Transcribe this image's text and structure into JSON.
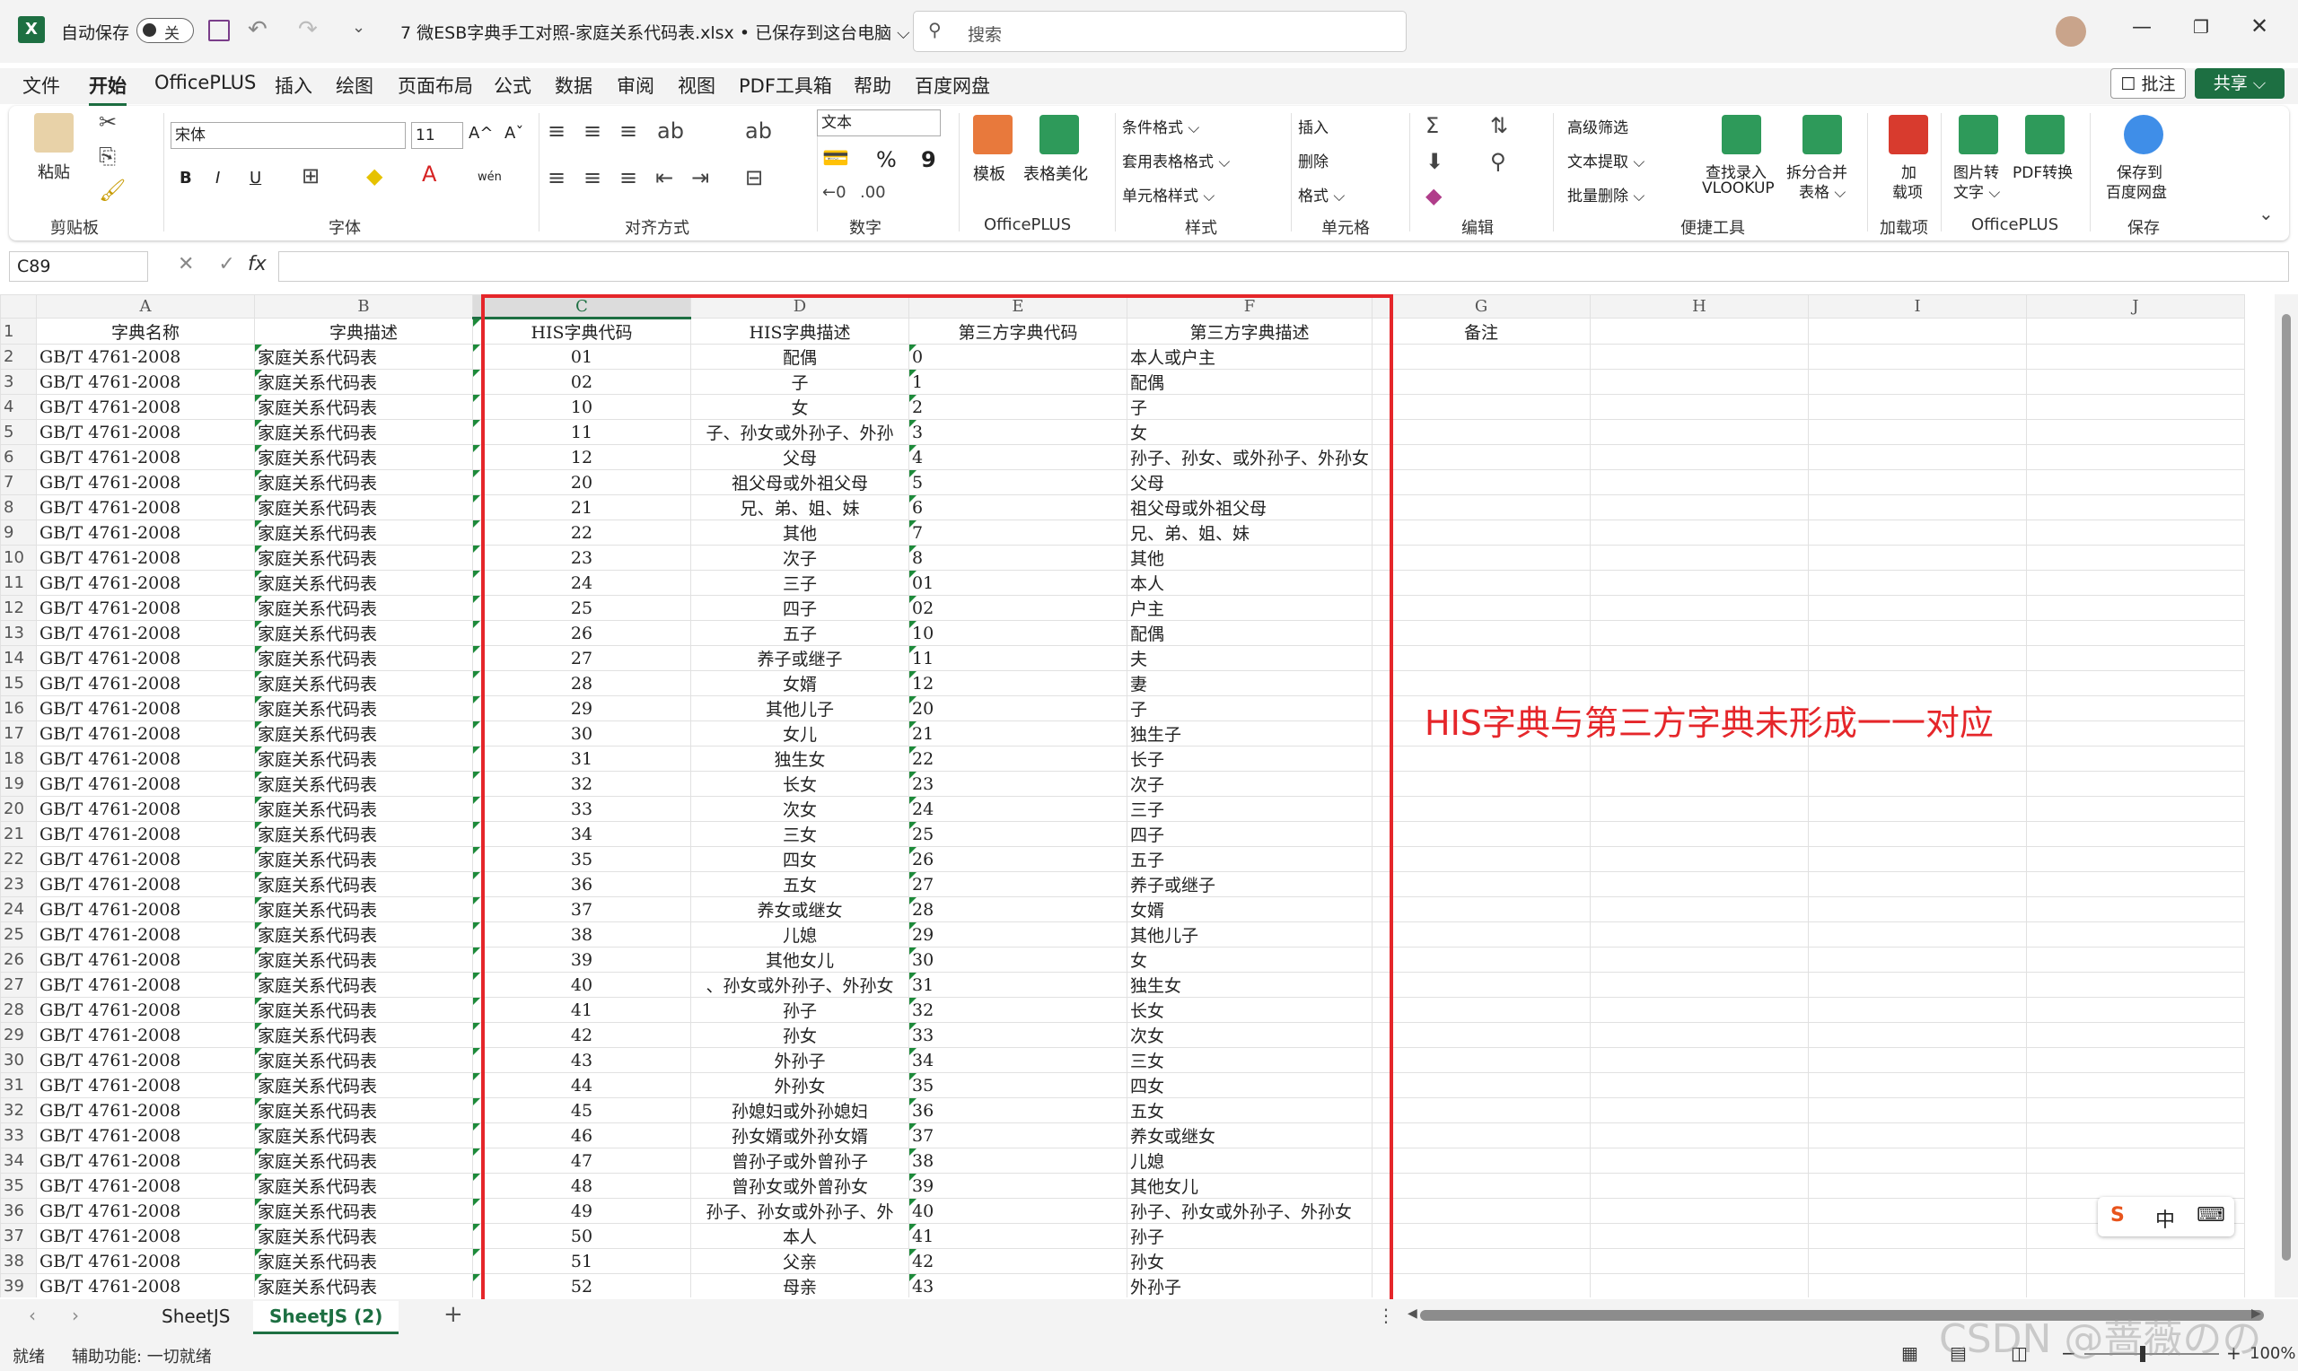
{
  "titlebar": {
    "autosave_label": "自动保存",
    "autosave_state": "关",
    "document_title": "7 微ESB字典手工对照-家庭关系代码表.xlsx • 已保存到这台电脑 ⌵",
    "search_placeholder": "搜索"
  },
  "menu_tabs": [
    "文件",
    "开始",
    "OfficePLUS",
    "插入",
    "绘图",
    "页面布局",
    "公式",
    "数据",
    "审阅",
    "视图",
    "PDF工具箱",
    "帮助",
    "百度网盘"
  ],
  "active_tab": "开始",
  "header_buttons": {
    "comment": "☐ 批注",
    "share": "共享 ⌵"
  },
  "ribbon": {
    "clipboard": {
      "paste": "粘贴",
      "label": "剪贴板"
    },
    "font": {
      "name": "宋体",
      "size": "11",
      "bold": "B",
      "italic": "I",
      "underline": "U",
      "label": "字体",
      "increase": "A^",
      "decrease": "Aˇ",
      "phonetic": "wén"
    },
    "alignment": {
      "label": "对齐方式"
    },
    "number": {
      "format": "文本",
      "percent": "%",
      "comma": "9",
      "label": "数字"
    },
    "officeplus": {
      "template": "模板",
      "beautify": "表格美化",
      "label": "OfficePLUS"
    },
    "styles": {
      "conditional": "条件格式 ⌵",
      "table_format": "套用表格格式 ⌵",
      "cell_style": "单元格样式 ⌵",
      "label": "样式"
    },
    "cells": {
      "insert": "插入",
      "delete": "删除",
      "format": "格式 ⌵",
      "label": "单元格"
    },
    "editing": {
      "label": "编辑"
    },
    "quick_tools": {
      "advanced_filter": "高级筛选",
      "text_extract": "文本提取 ⌵",
      "batch_delete": "批量删除 ⌵",
      "lookup_line1": "查找录入",
      "lookup_line2": "VLOOKUP",
      "split_line1": "拆分合并",
      "split_line2": "表格 ⌵",
      "label": "便捷工具"
    },
    "addins": {
      "line1": "加",
      "line2": "载项",
      "label": "加载项"
    },
    "officeplus2": {
      "img2text_line1": "图片转",
      "img2text_line2": "文字 ⌵",
      "pdf_convert": "PDF转换",
      "label": "OfficePLUS"
    },
    "save": {
      "line1": "保存到",
      "line2": "百度网盘",
      "label": "保存"
    }
  },
  "formula_bar": {
    "name_box": "C89",
    "fx": "fx",
    "ops": "✕ ✓",
    "formula": ""
  },
  "columns": [
    "A",
    "B",
    "C",
    "D",
    "E",
    "F",
    "G",
    "H",
    "I",
    "J"
  ],
  "selected_column": "C",
  "header_row": {
    "A": "字典名称",
    "B": "字典描述",
    "C": "HIS字典代码",
    "D": "HIS字典描述",
    "E": "第三方字典代码",
    "F": "第三方字典描述",
    "G": "备注"
  },
  "rows": [
    {
      "n": "2",
      "c": "01",
      "d": "配偶",
      "e": "0",
      "f": "本人或户主"
    },
    {
      "n": "3",
      "c": "02",
      "d": "子",
      "e": "1",
      "f": "配偶"
    },
    {
      "n": "4",
      "c": "10",
      "d": "女",
      "e": "2",
      "f": "子"
    },
    {
      "n": "5",
      "c": "11",
      "d": "子、孙女或外孙子、外孙",
      "e": "3",
      "f": "女"
    },
    {
      "n": "6",
      "c": "12",
      "d": "父母",
      "e": "4",
      "f": "孙子、孙女、或外孙子、外孙女"
    },
    {
      "n": "7",
      "c": "20",
      "d": "祖父母或外祖父母",
      "e": "5",
      "f": "父母"
    },
    {
      "n": "8",
      "c": "21",
      "d": "兄、弟、姐、妹",
      "e": "6",
      "f": "祖父母或外祖父母"
    },
    {
      "n": "9",
      "c": "22",
      "d": "其他",
      "e": "7",
      "f": "兄、弟、姐、妹"
    },
    {
      "n": "10",
      "c": "23",
      "d": "次子",
      "e": "8",
      "f": "其他"
    },
    {
      "n": "11",
      "c": "24",
      "d": "三子",
      "e": "01",
      "f": "本人"
    },
    {
      "n": "12",
      "c": "25",
      "d": "四子",
      "e": "02",
      "f": "户主"
    },
    {
      "n": "13",
      "c": "26",
      "d": "五子",
      "e": "10",
      "f": "配偶"
    },
    {
      "n": "14",
      "c": "27",
      "d": "养子或继子",
      "e": "11",
      "f": "夫"
    },
    {
      "n": "15",
      "c": "28",
      "d": "女婿",
      "e": "12",
      "f": "妻"
    },
    {
      "n": "16",
      "c": "29",
      "d": "其他儿子",
      "e": "20",
      "f": "子"
    },
    {
      "n": "17",
      "c": "30",
      "d": "女儿",
      "e": "21",
      "f": "独生子"
    },
    {
      "n": "18",
      "c": "31",
      "d": "独生女",
      "e": "22",
      "f": "长子"
    },
    {
      "n": "19",
      "c": "32",
      "d": "长女",
      "e": "23",
      "f": "次子"
    },
    {
      "n": "20",
      "c": "33",
      "d": "次女",
      "e": "24",
      "f": "三子"
    },
    {
      "n": "21",
      "c": "34",
      "d": "三女",
      "e": "25",
      "f": "四子"
    },
    {
      "n": "22",
      "c": "35",
      "d": "四女",
      "e": "26",
      "f": "五子"
    },
    {
      "n": "23",
      "c": "36",
      "d": "五女",
      "e": "27",
      "f": "养子或继子"
    },
    {
      "n": "24",
      "c": "37",
      "d": "养女或继女",
      "e": "28",
      "f": "女婿"
    },
    {
      "n": "25",
      "c": "38",
      "d": "儿媳",
      "e": "29",
      "f": "其他儿子"
    },
    {
      "n": "26",
      "c": "39",
      "d": "其他女儿",
      "e": "30",
      "f": "女"
    },
    {
      "n": "27",
      "c": "40",
      "d": "、孙女或外孙子、外孙女",
      "e": "31",
      "f": "独生女"
    },
    {
      "n": "28",
      "c": "41",
      "d": "孙子",
      "e": "32",
      "f": "长女"
    },
    {
      "n": "29",
      "c": "42",
      "d": "孙女",
      "e": "33",
      "f": "次女"
    },
    {
      "n": "30",
      "c": "43",
      "d": "外孙子",
      "e": "34",
      "f": "三女"
    },
    {
      "n": "31",
      "c": "44",
      "d": "外孙女",
      "e": "35",
      "f": "四女"
    },
    {
      "n": "32",
      "c": "45",
      "d": "孙媳妇或外孙媳妇",
      "e": "36",
      "f": "五女"
    },
    {
      "n": "33",
      "c": "46",
      "d": "孙女婿或外孙女婿",
      "e": "37",
      "f": "养女或继女"
    },
    {
      "n": "34",
      "c": "47",
      "d": "曾孙子或外曾孙子",
      "e": "38",
      "f": "儿媳"
    },
    {
      "n": "35",
      "c": "48",
      "d": "曾孙女或外曾孙女",
      "e": "39",
      "f": "其他女儿"
    },
    {
      "n": "36",
      "c": "49",
      "d": "孙子、孙女或外孙子、外",
      "e": "40",
      "f": "孙子、孙女或外孙子、外孙女"
    },
    {
      "n": "37",
      "c": "50",
      "d": "本人",
      "e": "41",
      "f": "孙子"
    },
    {
      "n": "38",
      "c": "51",
      "d": "父亲",
      "e": "42",
      "f": "孙女"
    },
    {
      "n": "39",
      "c": "52",
      "d": "母亲",
      "e": "43",
      "f": "外孙子"
    }
  ],
  "a_value": "GB/T 4761-2008",
  "b_value": "家庭关系代码表",
  "annotation": "HIS字典与第三方字典未形成一一对应",
  "ime": {
    "logo": "S",
    "lang": "中",
    "keyboard": "⌨"
  },
  "sheets": [
    "SheetJS",
    "SheetJS (2)"
  ],
  "active_sheet": "SheetJS (2)",
  "status": {
    "ready": "就绪",
    "accessibility": "辅助功能: 一切就绪",
    "zoom": "100%"
  },
  "watermark": "CSDN @蔷薇のの",
  "colors": {
    "excel_green": "#1d6f42",
    "annotation_red": "#e5262a"
  }
}
